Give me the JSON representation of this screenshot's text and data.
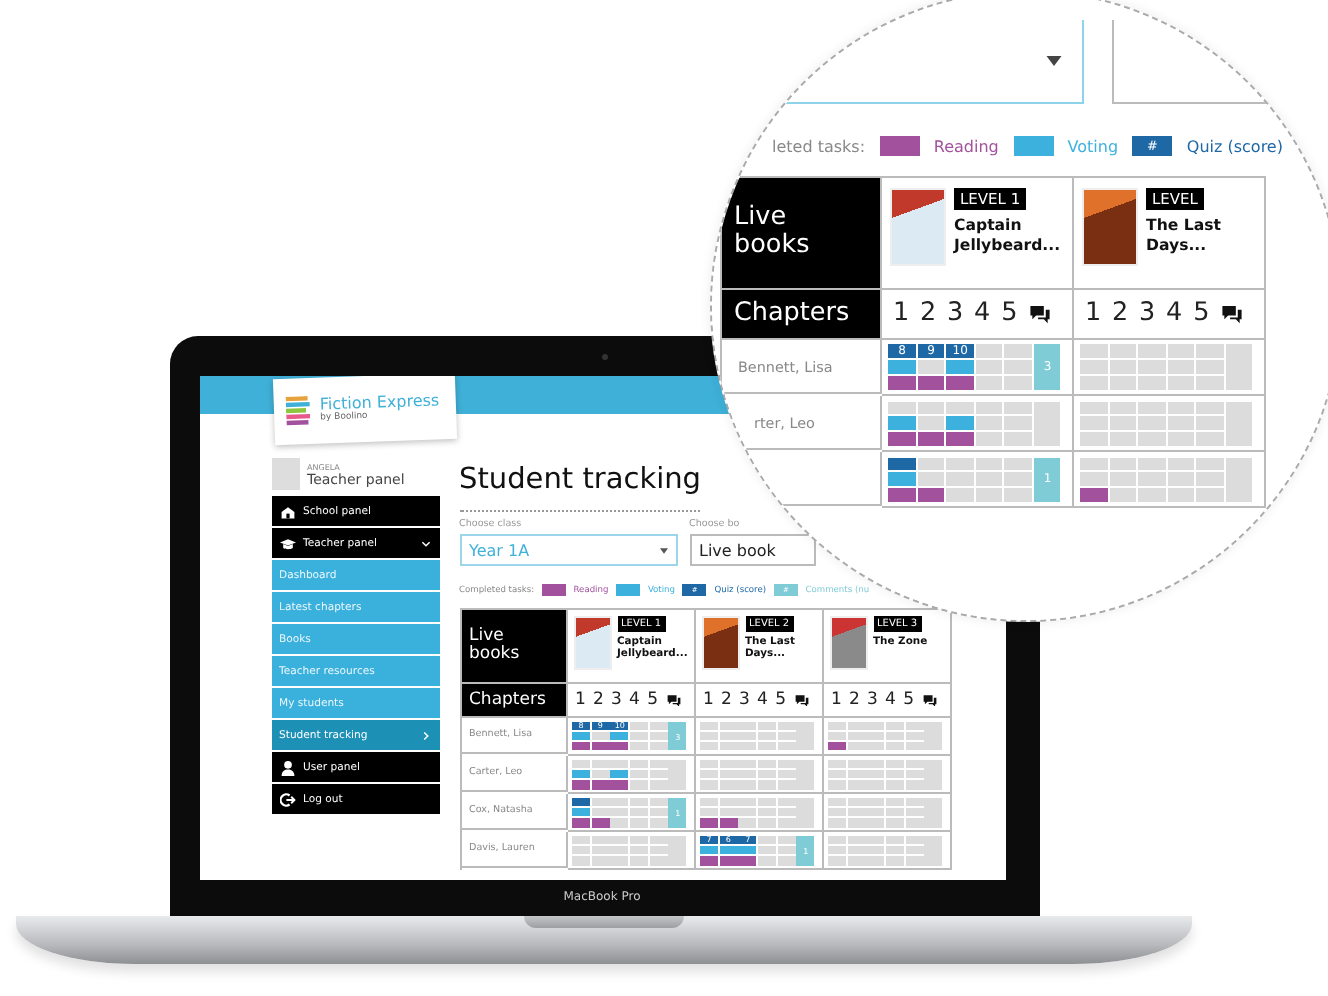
{
  "laptop": {
    "label": "MacBook Pro"
  },
  "app": {
    "logo": {
      "title": "Fiction Express",
      "subtitle": "by Boolino"
    },
    "user": {
      "name": "ANGELA",
      "role": "Teacher panel"
    },
    "menu": [
      {
        "label": "School panel",
        "expanded": false
      },
      {
        "label": "Teacher panel",
        "expanded": true,
        "children": [
          {
            "label": "Dashboard",
            "selected": false
          },
          {
            "label": "Latest chapters",
            "selected": false
          },
          {
            "label": "Books",
            "selected": false
          },
          {
            "label": "Teacher resources",
            "selected": false
          },
          {
            "label": "My students",
            "selected": false
          },
          {
            "label": "Student tracking",
            "selected": true
          }
        ]
      },
      {
        "label": "User panel",
        "expanded": false
      },
      {
        "label": "Log out",
        "expanded": false
      }
    ],
    "page_title": "Student tracking",
    "filters": [
      {
        "label": "Choose class",
        "value": "Year 1A"
      },
      {
        "label": "Choose bo",
        "value": "Live book"
      }
    ],
    "legend_label": "Completed tasks:",
    "legend": [
      {
        "kind": "reading",
        "label": "Reading"
      },
      {
        "kind": "voting",
        "label": "Voting"
      },
      {
        "kind": "quiz",
        "symbol": "#",
        "label": "Quiz (score)"
      },
      {
        "kind": "comments",
        "symbol": "#",
        "label": "Comments (nu"
      }
    ],
    "table": {
      "corner": "Live books",
      "chapters_label": "Chapters",
      "books": [
        {
          "level": "LEVEL 1",
          "title": "Captain Jellybeard...",
          "chapters": [
            "1",
            "2",
            "3",
            "4",
            "5"
          ]
        },
        {
          "level": "LEVEL 2",
          "title": "The Last Days...",
          "chapters": [
            "1",
            "2",
            "3",
            "4",
            "5"
          ]
        },
        {
          "level": "LEVEL 3",
          "title": "The Zone",
          "chapters": [
            "1",
            "2",
            "3",
            "4",
            "5"
          ]
        }
      ],
      "students": [
        {
          "name": "Bennett, Lisa",
          "books": [
            {
              "quiz": [
                true,
                true,
                true,
                false,
                false
              ],
              "scores": [
                "8",
                "9",
                "10"
              ],
              "voting": [
                true,
                false,
                true,
                false,
                false
              ],
              "reading": [
                true,
                true,
                true,
                false,
                false
              ],
              "comments": "3"
            },
            {
              "quiz": [
                false,
                false,
                false,
                false,
                false
              ],
              "voting": [
                false,
                false,
                false,
                false,
                false
              ],
              "reading": [
                false,
                false,
                false,
                false,
                false
              ]
            },
            {
              "quiz": [
                false,
                false,
                false,
                false,
                false
              ],
              "voting": [
                false,
                false,
                false,
                false,
                false
              ],
              "reading": [
                true,
                false,
                false,
                false,
                false
              ]
            }
          ]
        },
        {
          "name": "Carter, Leo",
          "books": [
            {
              "quiz": [
                false,
                false,
                false,
                false,
                false
              ],
              "voting": [
                true,
                false,
                true,
                false,
                false
              ],
              "reading": [
                true,
                true,
                true,
                false,
                false
              ]
            },
            {
              "quiz": [
                false,
                false,
                false,
                false,
                false
              ],
              "voting": [
                false,
                false,
                false,
                false,
                false
              ],
              "reading": [
                false,
                false,
                false,
                false,
                false
              ]
            },
            {
              "quiz": [
                false,
                false,
                false,
                false,
                false
              ],
              "voting": [
                false,
                false,
                false,
                false,
                false
              ],
              "reading": [
                false,
                false,
                false,
                false,
                false
              ]
            }
          ]
        },
        {
          "name": "Cox, Natasha",
          "books": [
            {
              "quiz": [
                true,
                false,
                false,
                false,
                false
              ],
              "voting": [
                true,
                false,
                false,
                false,
                false
              ],
              "reading": [
                true,
                true,
                false,
                false,
                false
              ],
              "comments": "1"
            },
            {
              "quiz": [
                false,
                false,
                false,
                false,
                false
              ],
              "voting": [
                false,
                false,
                false,
                false,
                false
              ],
              "reading": [
                true,
                true,
                false,
                false,
                false
              ]
            },
            {
              "quiz": [
                false,
                false,
                false,
                false,
                false
              ],
              "voting": [
                false,
                false,
                false,
                false,
                false
              ],
              "reading": [
                false,
                false,
                false,
                false,
                false
              ]
            }
          ]
        },
        {
          "name": "Davis, Lauren",
          "books": [
            {
              "quiz": [
                false,
                false,
                false,
                false,
                false
              ],
              "voting": [
                false,
                false,
                false,
                false,
                false
              ],
              "reading": [
                false,
                false,
                false,
                false,
                false
              ]
            },
            {
              "quiz": [
                true,
                true,
                true,
                false,
                false
              ],
              "scores": [
                "7",
                "6",
                "7"
              ],
              "voting": [
                true,
                true,
                true,
                false,
                false
              ],
              "reading": [
                true,
                true,
                true,
                false,
                false
              ],
              "comments": "1"
            },
            {
              "quiz": [
                false,
                false,
                false,
                false,
                false
              ],
              "voting": [
                false,
                false,
                false,
                false,
                false
              ],
              "reading": [
                false,
                false,
                false,
                false,
                false
              ]
            }
          ]
        }
      ]
    }
  },
  "lens": {
    "legend_label": "leted tasks:",
    "legend": [
      {
        "kind": "reading",
        "label": "Reading"
      },
      {
        "kind": "voting",
        "label": "Voting"
      },
      {
        "kind": "quiz",
        "symbol": "#",
        "label": "Quiz (score)"
      }
    ],
    "table": {
      "corner": "Live books",
      "chapters_label": "Chapters",
      "books": [
        {
          "level": "LEVEL 1",
          "title": "Captain Jellybeard...",
          "chapters": [
            "1",
            "2",
            "3",
            "4",
            "5"
          ]
        },
        {
          "level": "LEVEL",
          "title": "The Last Days...",
          "chapters": [
            "1",
            "2",
            "3",
            "4",
            "5"
          ]
        }
      ],
      "students": [
        {
          "name": "Bennett, Lisa",
          "books": [
            {
              "quiz": [
                true,
                true,
                true,
                false,
                false
              ],
              "scores": [
                "8",
                "9",
                "10"
              ],
              "voting": [
                true,
                false,
                true,
                false,
                false
              ],
              "reading": [
                true,
                true,
                true,
                false,
                false
              ],
              "comments": "3"
            },
            {
              "quiz": [
                false,
                false,
                false,
                false,
                false
              ],
              "voting": [
                false,
                false,
                false,
                false,
                false
              ],
              "reading": [
                false,
                false,
                false,
                false,
                false
              ]
            }
          ]
        },
        {
          "name": "rter, Leo",
          "books": [
            {
              "quiz": [
                false,
                false,
                false,
                false,
                false
              ],
              "voting": [
                true,
                false,
                true,
                false,
                false
              ],
              "reading": [
                true,
                true,
                true,
                false,
                false
              ]
            },
            {
              "quiz": [
                false,
                false,
                false,
                false,
                false
              ],
              "voting": [
                false,
                false,
                false,
                false,
                false
              ],
              "reading": [
                false,
                false,
                false,
                false,
                false
              ]
            }
          ]
        },
        {
          "books": [
            {
              "quiz": [
                true,
                false,
                false,
                false,
                false
              ],
              "voting": [
                true,
                false,
                false,
                false,
                false
              ],
              "reading": [
                true,
                true,
                false,
                false,
                false
              ],
              "comments": "1"
            },
            {
              "quiz": [
                false,
                false,
                false,
                false,
                false
              ],
              "voting": [
                false,
                false,
                false,
                false,
                false
              ],
              "reading": [
                true,
                false,
                false,
                false,
                false
              ]
            }
          ]
        }
      ]
    }
  }
}
